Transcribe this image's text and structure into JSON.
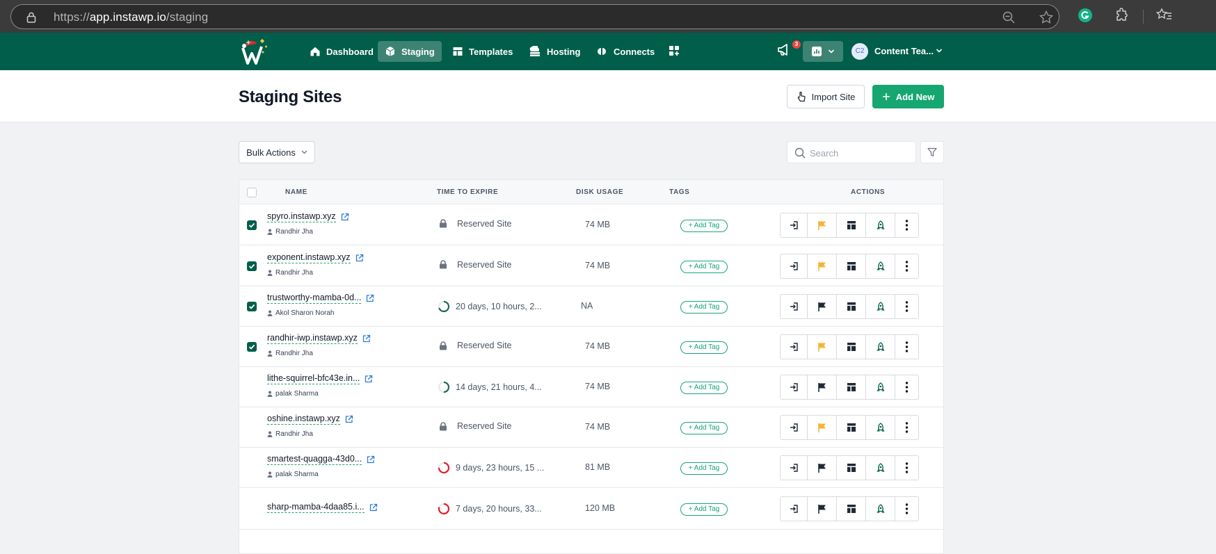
{
  "browser": {
    "url_prefix": "https://",
    "url_host": "app.instawp.io",
    "url_path": "/staging"
  },
  "colors": {
    "brand_green": "#005e4a",
    "accent_green": "#16a672",
    "flag_orange": "#f4b43a",
    "flag_dark": "#1f2937",
    "timer_green": "#1a6b58",
    "timer_red": "#e11d2a"
  },
  "nav": {
    "items": [
      {
        "label": "Dashboard",
        "icon": "home-icon"
      },
      {
        "label": "Staging",
        "icon": "cube-icon"
      },
      {
        "label": "Templates",
        "icon": "template-icon"
      },
      {
        "label": "Hosting",
        "icon": "cloud-server-icon"
      },
      {
        "label": "Connects",
        "icon": "connects-icon"
      }
    ],
    "notification_count": "3",
    "team_initials": "C2",
    "team_name": "Content Tea..."
  },
  "page": {
    "title": "Staging Sites",
    "import_label": "Import Site",
    "add_label": "Add New"
  },
  "toolbar": {
    "bulk_label": "Bulk Actions",
    "search_placeholder": "Search"
  },
  "table": {
    "headers": {
      "name": "NAME",
      "expire": "TIME TO EXPIRE",
      "disk": "DISK USAGE",
      "tags": "TAGS",
      "actions": "ACTIONS"
    },
    "add_tag_label": "+ Add Tag",
    "rows": [
      {
        "name": "spyro.instawp.xyz",
        "owner": "Randhir Jha",
        "expire": "Reserved Site",
        "expire_type": "reserved",
        "disk": "74 MB",
        "checked": true,
        "flagged": true
      },
      {
        "name": "exponent.instawp.xyz",
        "owner": "Randhir Jha",
        "expire": "Reserved Site",
        "expire_type": "reserved",
        "disk": "74 MB",
        "checked": true,
        "flagged": true
      },
      {
        "name": "trustworthy-mamba-0d...",
        "owner": "Akol Sharon Norah",
        "expire": "20 days, 10 hours, 2...",
        "expire_type": "timer",
        "timer_color": "#1a6b58",
        "timer_fraction": 0.7,
        "disk": "NA",
        "checked": true,
        "flagged": false
      },
      {
        "name": "randhir-iwp.instawp.xyz",
        "owner": "Randhir Jha",
        "expire": "Reserved Site",
        "expire_type": "reserved",
        "disk": "74 MB",
        "checked": true,
        "flagged": true
      },
      {
        "name": "lithe-squirrel-bfc43e.in...",
        "owner": "palak Sharma",
        "expire": "14 days, 21 hours, 4...",
        "expire_type": "timer",
        "timer_color": "#1a6b58",
        "timer_fraction": 0.5,
        "disk": "74 MB",
        "checked": false,
        "flagged": false
      },
      {
        "name": "oshine.instawp.xyz",
        "owner": "Randhir Jha",
        "expire": "Reserved Site",
        "expire_type": "reserved",
        "disk": "74 MB",
        "checked": false,
        "flagged": true
      },
      {
        "name": "smartest-quagga-43d0...",
        "owner": "palak Sharma",
        "expire": "9 days, 23 hours, 15 ...",
        "expire_type": "timer",
        "timer_color": "#e11d2a",
        "timer_fraction": 0.75,
        "disk": "81 MB",
        "checked": false,
        "flagged": false
      },
      {
        "name": "sharp-mamba-4daa85.i...",
        "owner": "",
        "expire": "7 days, 20 hours, 33...",
        "expire_type": "timer",
        "timer_color": "#e11d2a",
        "timer_fraction": 0.8,
        "disk": "120 MB",
        "checked": false,
        "flagged": false
      }
    ]
  }
}
